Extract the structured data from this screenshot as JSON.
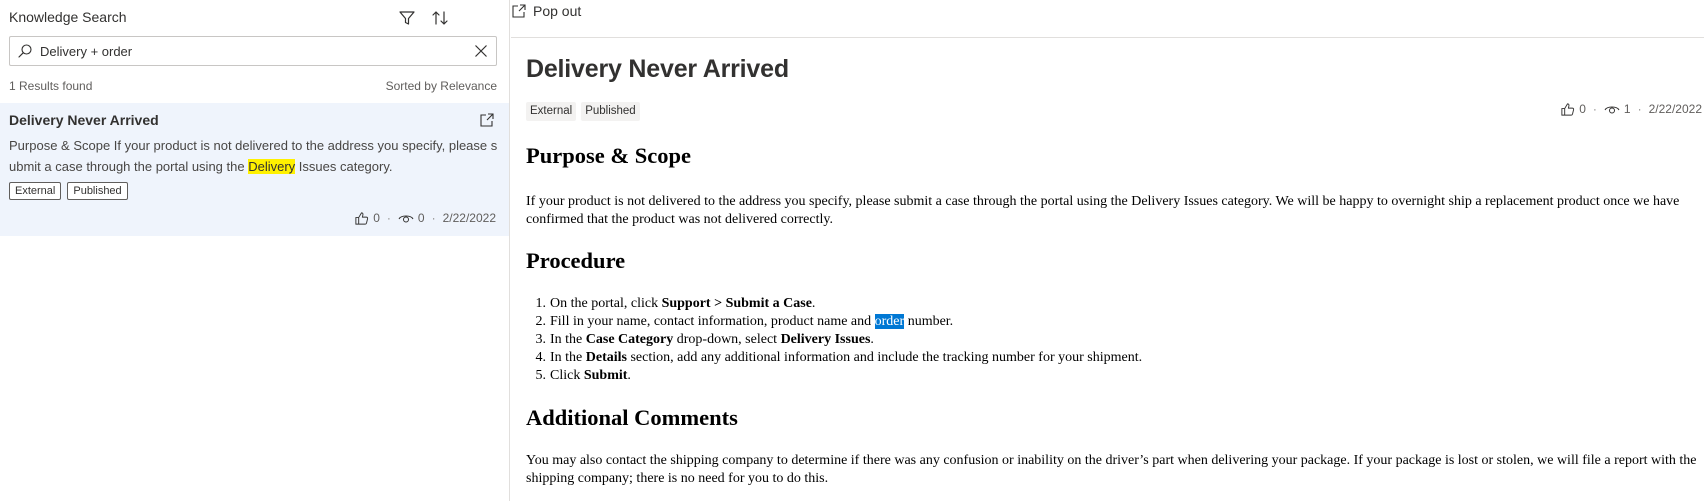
{
  "search_panel": {
    "title": "Knowledge Search",
    "filter_icon": "filter-icon",
    "sort_icon": "sort-icon",
    "search": {
      "value": "Delivery + order",
      "placeholder": ""
    },
    "results_count": "1 Results found",
    "sorted_by": "Sorted by Relevance"
  },
  "result": {
    "title": "Delivery Never Arrived",
    "snippet_before": "Purpose & Scope If your product is not delivered to the address you specify, please submit a case through the portal using the ",
    "snippet_highlight": "Delivery",
    "snippet_after": " Issues category.",
    "tags": [
      "External",
      "Published"
    ],
    "likes": "0",
    "views": "0",
    "date": "2/22/2022"
  },
  "article": {
    "popout_label": "Pop out",
    "title": "Delivery Never Arrived",
    "tags": [
      "External",
      "Published"
    ],
    "likes": "0",
    "views": "1",
    "date": "2/22/2022",
    "sections": {
      "purpose_heading": "Purpose & Scope",
      "purpose_text": "If your product is not delivered to the address you specify, please submit a case through the portal using the Delivery Issues category. We will be happy to overnight ship a replacement product once we have confirmed that the product was not delivered correctly.",
      "procedure_heading": "Procedure",
      "steps": [
        {
          "num": "1.",
          "a": "On the portal, click ",
          "b": "Support > Submit a Case",
          "c": "."
        },
        {
          "num": "2.",
          "a": "Fill in your name, contact information, product name and ",
          "sel": "order",
          "c": " number."
        },
        {
          "num": "3.",
          "a": "In the ",
          "b": "Case Category",
          "c": " drop-down, select ",
          "d": "Delivery Issues",
          "e": "."
        },
        {
          "num": "4.",
          "a": "In the ",
          "b": "Details",
          "c": " section, add any additional information and include the tracking number for your shipment."
        },
        {
          "num": "5.",
          "a": "Click ",
          "b": "Submit",
          "c": "."
        }
      ],
      "comments_heading": "Additional Comments",
      "comments_text": "You may also contact the shipping company to determine if there was any confusion or inability on the driver’s part when delivering your package. If your package is lost or stolen, we will file a report with the shipping company; there is no need for you to do this."
    }
  },
  "colors": {
    "accent": "#0078d4",
    "selected_card_bg": "#eff4fc",
    "highlight": "#fff100"
  }
}
